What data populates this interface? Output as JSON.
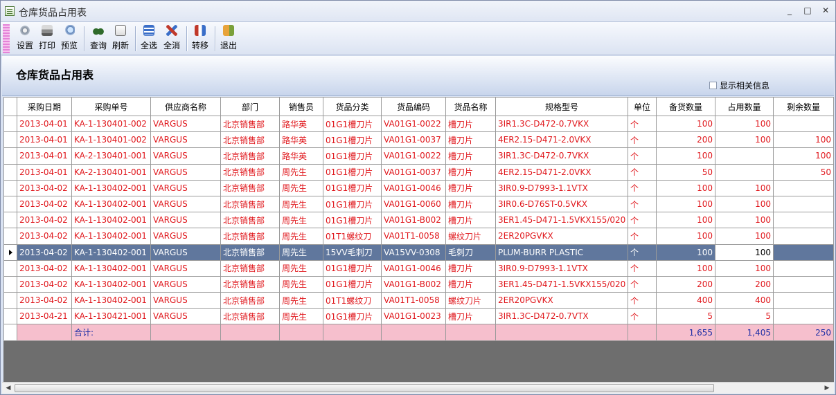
{
  "window": {
    "title": "仓库货品占用表",
    "controls": {
      "minimize": "_",
      "maximize": "□",
      "close": "✕"
    }
  },
  "toolbar": {
    "items": [
      {
        "label": "设置",
        "icon": "settings-icon"
      },
      {
        "label": "打印",
        "icon": "printer-icon"
      },
      {
        "label": "预览",
        "icon": "preview-icon"
      },
      {
        "label": "查询",
        "icon": "binoculars-icon"
      },
      {
        "label": "刷新",
        "icon": "refresh-icon"
      },
      {
        "label": "全选",
        "icon": "select-all-icon"
      },
      {
        "label": "全消",
        "icon": "deselect-all-icon"
      },
      {
        "label": "转移",
        "icon": "transfer-icon"
      },
      {
        "label": "退出",
        "icon": "exit-icon"
      }
    ]
  },
  "header": {
    "title": "仓库货品占用表",
    "show_related_label": "显示相关信息",
    "show_related_checked": false
  },
  "grid": {
    "columns": [
      "采购日期",
      "采购单号",
      "供应商名称",
      "部门",
      "销售员",
      "货品分类",
      "货品编码",
      "货品名称",
      "规格型号",
      "单位",
      "备货数量",
      "占用数量",
      "剩余数量"
    ],
    "rows": [
      [
        "2013-04-01",
        "KA-1-130401-002",
        "VARGUS",
        "北京销售部",
        "路华英",
        "01G1槽刀片",
        "VA01G1-0022",
        "槽刀片",
        "3IR1.3C-D472-0.7VKX",
        "个",
        "100",
        "100",
        ""
      ],
      [
        "2013-04-01",
        "KA-1-130401-002",
        "VARGUS",
        "北京销售部",
        "路华英",
        "01G1槽刀片",
        "VA01G1-0037",
        "槽刀片",
        "4ER2.15-D471-2.0VKX",
        "个",
        "200",
        "100",
        "100"
      ],
      [
        "2013-04-01",
        "KA-2-130401-001",
        "VARGUS",
        "北京销售部",
        "路华英",
        "01G1槽刀片",
        "VA01G1-0022",
        "槽刀片",
        "3IR1.3C-D472-0.7VKX",
        "个",
        "100",
        "",
        "100"
      ],
      [
        "2013-04-01",
        "KA-2-130401-001",
        "VARGUS",
        "北京销售部",
        "周先生",
        "01G1槽刀片",
        "VA01G1-0037",
        "槽刀片",
        "4ER2.15-D471-2.0VKX",
        "个",
        "50",
        "",
        "50"
      ],
      [
        "2013-04-02",
        "KA-1-130402-001",
        "VARGUS",
        "北京销售部",
        "周先生",
        "01G1槽刀片",
        "VA01G1-0046",
        "槽刀片",
        "3IR0.9-D7993-1.1VTX",
        "个",
        "100",
        "100",
        ""
      ],
      [
        "2013-04-02",
        "KA-1-130402-001",
        "VARGUS",
        "北京销售部",
        "周先生",
        "01G1槽刀片",
        "VA01G1-0060",
        "槽刀片",
        "3IR0.6-D76ST-0.5VKX",
        "个",
        "100",
        "100",
        ""
      ],
      [
        "2013-04-02",
        "KA-1-130402-001",
        "VARGUS",
        "北京销售部",
        "周先生",
        "01G1槽刀片",
        "VA01G1-B002",
        "槽刀片",
        "3ER1.45-D471-1.5VKX155/020",
        "个",
        "100",
        "100",
        ""
      ],
      [
        "2013-04-02",
        "KA-1-130402-001",
        "VARGUS",
        "北京销售部",
        "周先生",
        "01T1螺纹刀",
        "VA01T1-0058",
        "螺纹刀片",
        "2ER20PGVKX",
        "个",
        "100",
        "100",
        ""
      ],
      [
        "2013-04-02",
        "KA-1-130402-001",
        "VARGUS",
        "北京销售部",
        "周先生",
        "15VV毛刺刀",
        "VA15VV-0308",
        "毛刺刀",
        "PLUM-BURR PLASTIC",
        "个",
        "100",
        "100",
        ""
      ],
      [
        "2013-04-02",
        "KA-1-130402-001",
        "VARGUS",
        "北京销售部",
        "周先生",
        "01G1槽刀片",
        "VA01G1-0046",
        "槽刀片",
        "3IR0.9-D7993-1.1VTX",
        "个",
        "100",
        "100",
        ""
      ],
      [
        "2013-04-02",
        "KA-1-130402-001",
        "VARGUS",
        "北京销售部",
        "周先生",
        "01G1槽刀片",
        "VA01G1-B002",
        "槽刀片",
        "3ER1.45-D471-1.5VKX155/020",
        "个",
        "200",
        "200",
        ""
      ],
      [
        "2013-04-02",
        "KA-1-130402-001",
        "VARGUS",
        "北京销售部",
        "周先生",
        "01T1螺纹刀",
        "VA01T1-0058",
        "螺纹刀片",
        "2ER20PGVKX",
        "个",
        "400",
        "400",
        ""
      ],
      [
        "2013-04-21",
        "KA-1-130421-001",
        "VARGUS",
        "北京销售部",
        "周先生",
        "01G1槽刀片",
        "VA01G1-0023",
        "槽刀片",
        "3IR1.3C-D472-0.7VTX",
        "个",
        "5",
        "5",
        ""
      ]
    ],
    "selected_row_index": 8,
    "total": {
      "label": "合计:",
      "stock_qty": "1,655",
      "occupied_qty": "1,405",
      "remaining_qty": "250"
    }
  },
  "colors": {
    "row_text": "#e0171c",
    "selected_row_bg": "#60779d",
    "total_row_bg": "#f6bfcd",
    "total_text": "#1f2fa6"
  }
}
